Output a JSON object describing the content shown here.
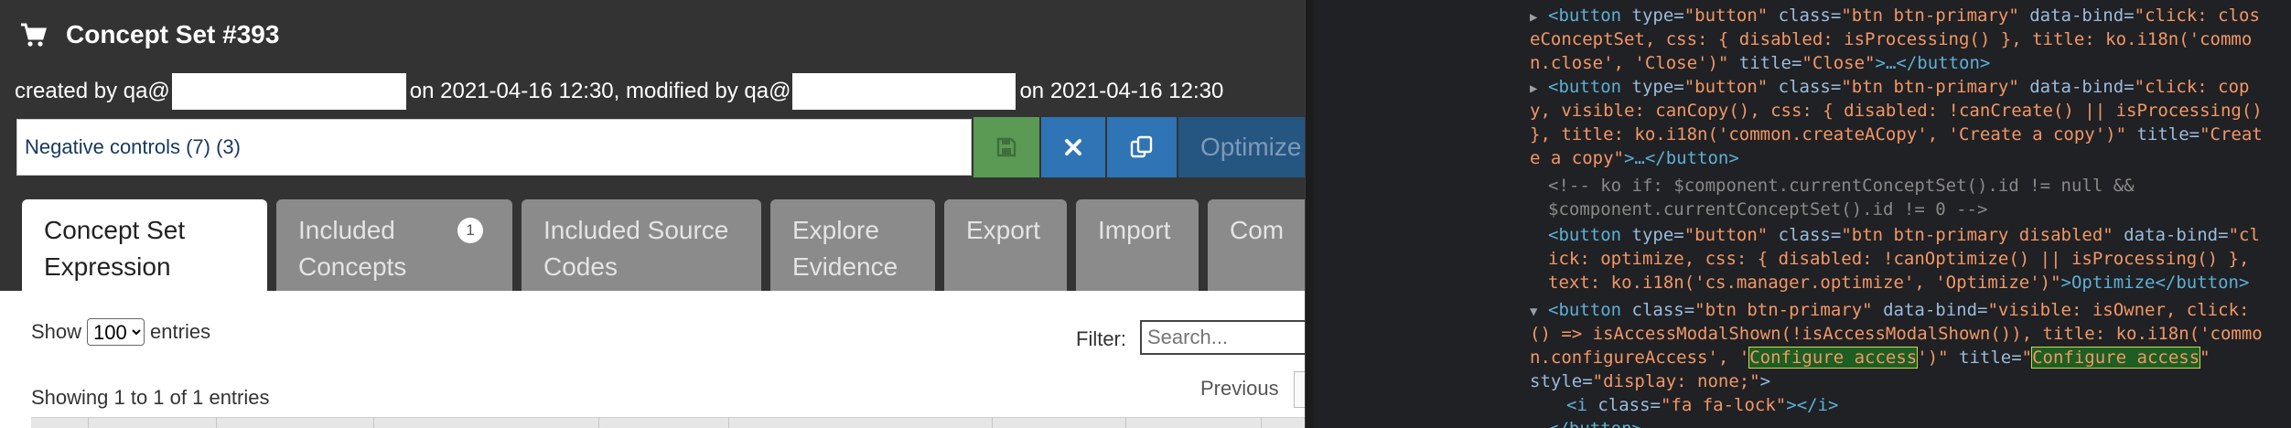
{
  "app": {
    "page_title": "Concept Set #393",
    "meta": {
      "created_prefix": "created by qa@",
      "created_on": "on 2021-04-16 12:30, modified by qa@",
      "modified_on": "on 2021-04-16 12:30"
    },
    "concept_set_name": "Negative controls (7) (3)",
    "toolbar": {
      "optimize_label": "Optimize",
      "colors": {
        "save": "#5a9a55",
        "close": "#2f74b4",
        "copy": "#2f74b4",
        "optimize": "#255581"
      }
    },
    "tabs": [
      {
        "line1": "Concept Set",
        "line2": "Expression",
        "active": true
      },
      {
        "line1": "Included",
        "line2": "Concepts",
        "badge": "1"
      },
      {
        "line1": "Included Source",
        "line2": "Codes"
      },
      {
        "line1": "Explore",
        "line2": "Evidence"
      },
      {
        "line1": "Export",
        "line2": ""
      },
      {
        "line1": "Import",
        "line2": ""
      },
      {
        "line1": "Com",
        "line2": ""
      }
    ],
    "table_controls": {
      "show_label": "Show",
      "page_size": "100",
      "entries_label": "entries",
      "filter_label": "Filter:",
      "filter_placeholder": "Search...",
      "info": "Showing 1 to 1 of 1 entries",
      "previous_label": "Previous"
    }
  },
  "devtools": {
    "lines": {
      "l1a": "<button",
      "l1b": " type=",
      "l1c": "\"button\"",
      "l1d": " class=",
      "l1e": "\"btn btn-primary\"",
      "l1f": " data-bind=",
      "l1g": "\"click: clos",
      "l2": "eConceptSet, css: { disabled: isProcessing() }, title: ko.i18n('commo",
      "l3a": "n.close', 'Close')\"",
      "l3b": " title=",
      "l3c": "\"Close\"",
      "l3d": ">…</button>",
      "l4a": "<button",
      "l4b": " type=",
      "l4c": "\"button\"",
      "l4d": " class=",
      "l4e": "\"btn btn-primary\"",
      "l4f": " data-bind=",
      "l4g": "\"click: cop",
      "l5": "y, visible: canCopy(), css: { disabled: !canCreate() || isProcessing()",
      "l6a": "}, title: ko.i18n('common.createACopy', 'Create a copy')\"",
      "l6b": " title=",
      "l6c": "\"Creat",
      "l7a": "e a copy\"",
      "l7b": ">…</button>",
      "l8": "<!-- ko if: $component.currentConceptSet().id != null &&",
      "l9": "$component.currentConceptSet().id != 0 -->",
      "l10a": "<button",
      "l10b": " type=",
      "l10c": "\"button\"",
      "l10d": " class=",
      "l10e": "\"btn btn-primary disabled\"",
      "l10f": " data-bind=",
      "l10g": "\"cl",
      "l11": "ick: optimize, css: { disabled: !canOptimize() || isProcessing() },",
      "l12a": "text: ko.i18n('cs.manager.optimize', 'Optimize')\"",
      "l12b": ">Optimize</button>",
      "l13a": "<button",
      "l13b": " class=",
      "l13c": "\"btn btn-primary\"",
      "l13d": " data-bind=",
      "l13e": "\"visible: isOwner, click:",
      "l14": "() => isAccessModalShown(!isAccessModalShown()), title: ko.i18n('commo",
      "l15a": "n.configureAccess', '",
      "l15b": "Configure access",
      "l15c": "')\"",
      "l15d": " title=",
      "l15e": "\"",
      "l15f": "Configure access",
      "l15g": "\"",
      "l16a": "style=",
      "l16b": "\"display: none;\"",
      "l16c": ">",
      "l17a": "<i",
      "l17b": " class=",
      "l17c": "\"fa fa-lock\"",
      "l17d": "></i>",
      "l18": "</button>"
    }
  }
}
